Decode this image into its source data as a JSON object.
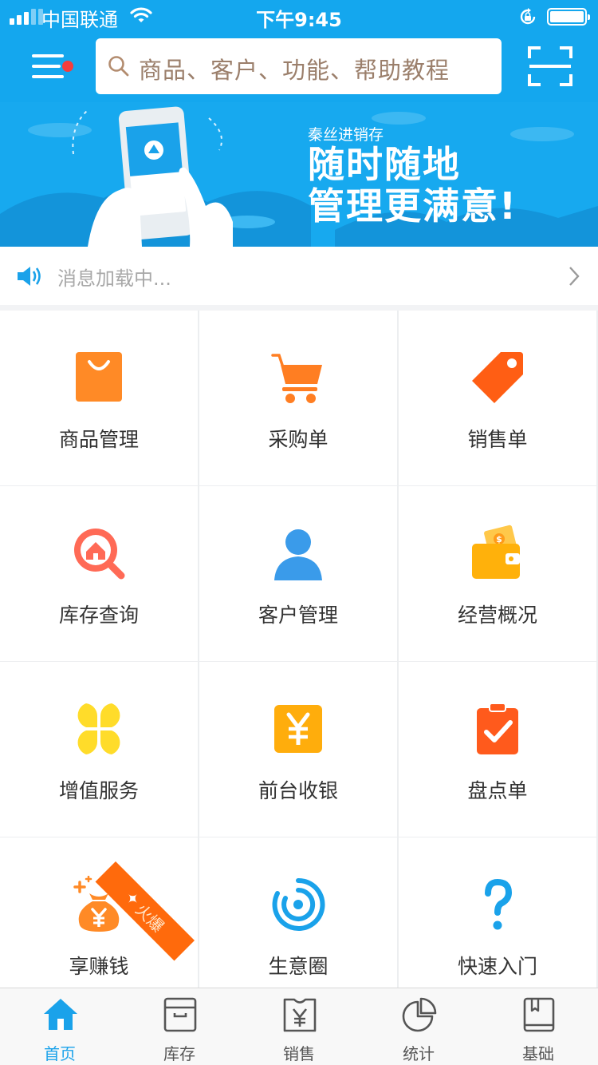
{
  "status_bar": {
    "carrier": "中国联通",
    "time": "下午9:45"
  },
  "header": {
    "search_placeholder": "商品、客户、功能、帮助教程"
  },
  "banner": {
    "subtitle": "秦丝进销存",
    "title_line1": "随时随地",
    "title_line2": "管理更满意!"
  },
  "notice": {
    "text": "消息加载中..."
  },
  "grid": {
    "items": [
      {
        "label": "商品管理",
        "icon": "shopping-bag-icon",
        "color": "#ff8a26"
      },
      {
        "label": "采购单",
        "icon": "cart-icon",
        "color": "#ff7e22"
      },
      {
        "label": "销售单",
        "icon": "price-tag-icon",
        "color": "#ff5e14"
      },
      {
        "label": "库存查询",
        "icon": "inventory-search-icon",
        "color": "#ff6a56"
      },
      {
        "label": "客户管理",
        "icon": "customer-icon",
        "color": "#3a9bea"
      },
      {
        "label": "经营概况",
        "icon": "wallet-icon",
        "color": "#ffb10b"
      },
      {
        "label": "增值服务",
        "icon": "clover-icon",
        "color": "#ffdc2a"
      },
      {
        "label": "前台收银",
        "icon": "yen-cashier-icon",
        "color": "#ffad0c"
      },
      {
        "label": "盘点单",
        "icon": "clipboard-check-icon",
        "color": "#ff5a1c"
      },
      {
        "label": "享赚钱",
        "icon": "money-bag-icon",
        "color": "#ff8a26",
        "badge": "火爆"
      },
      {
        "label": "生意圈",
        "icon": "circle-ring-icon",
        "color": "#1aa2ea"
      },
      {
        "label": "快速入门",
        "icon": "question-icon",
        "color": "#1aa2ea"
      }
    ]
  },
  "tabbar": {
    "tabs": [
      {
        "label": "首页",
        "icon": "home-icon",
        "active": true
      },
      {
        "label": "库存",
        "icon": "inventory-box-icon",
        "active": false
      },
      {
        "label": "销售",
        "icon": "sales-receipt-icon",
        "active": false
      },
      {
        "label": "统计",
        "icon": "pie-chart-icon",
        "active": false
      },
      {
        "label": "基础",
        "icon": "book-icon",
        "active": false
      }
    ]
  },
  "colors": {
    "primary": "#14a7ee",
    "active_tab": "#1aa2ea",
    "notification_dot": "#f43d3d"
  }
}
